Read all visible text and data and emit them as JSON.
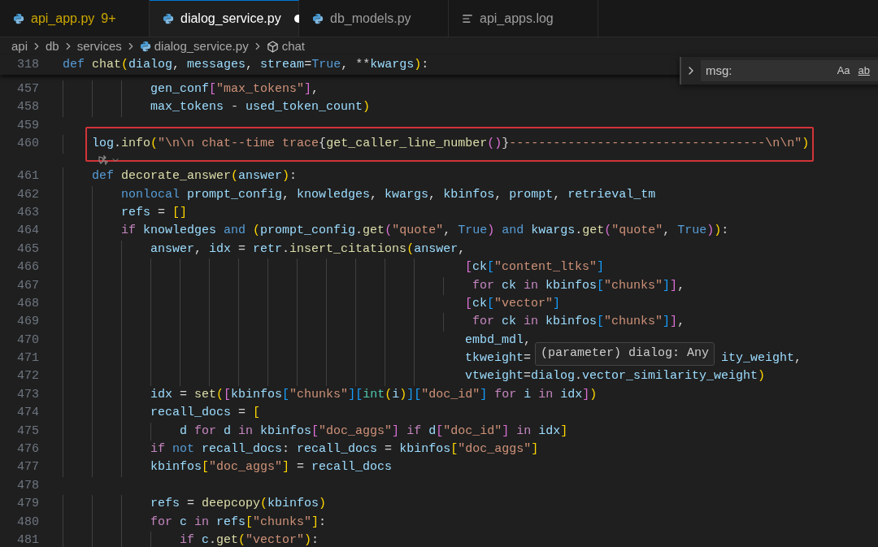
{
  "tabs": [
    {
      "label": "api_app.py",
      "badge": "9+",
      "kind": "python",
      "selected": false,
      "modified": false,
      "errors": true
    },
    {
      "label": "dialog_service.py",
      "kind": "python",
      "selected": true,
      "modified": true,
      "errors": false
    },
    {
      "label": "db_models.py",
      "kind": "python",
      "selected": false,
      "modified": false,
      "errors": false
    },
    {
      "label": "api_apps.log",
      "kind": "log",
      "selected": false,
      "modified": false,
      "errors": false
    }
  ],
  "breadcrumbs": [
    {
      "label": "api",
      "kind": "folder"
    },
    {
      "label": "db",
      "kind": "folder"
    },
    {
      "label": "services",
      "kind": "folder"
    },
    {
      "label": "dialog_service.py",
      "kind": "python"
    },
    {
      "label": "chat",
      "kind": "symbol"
    }
  ],
  "sticky_line": {
    "number": "318",
    "tokens": [
      {
        "kind": "kw",
        "text": "def "
      },
      {
        "kind": "fn",
        "text": "chat"
      },
      {
        "kind": "b1",
        "text": "("
      },
      {
        "kind": "par",
        "text": "dialog"
      },
      {
        "kind": "p",
        "text": ", "
      },
      {
        "kind": "par",
        "text": "messages"
      },
      {
        "kind": "p",
        "text": ", "
      },
      {
        "kind": "par",
        "text": "stream"
      },
      {
        "kind": "p",
        "text": "="
      },
      {
        "kind": "kw",
        "text": "True"
      },
      {
        "kind": "p",
        "text": ", **"
      },
      {
        "kind": "par",
        "text": "kwargs"
      },
      {
        "kind": "b1",
        "text": ")"
      },
      {
        "kind": "p",
        "text": ":"
      }
    ]
  },
  "lines": [
    {
      "number": "457",
      "tokens": [
        {
          "kind": "var",
          "text": "            gen_conf"
        },
        {
          "kind": "b2",
          "text": "["
        },
        {
          "kind": "str",
          "text": "\"max_tokens\""
        },
        {
          "kind": "b2",
          "text": "]"
        },
        {
          "kind": "p",
          "text": ","
        }
      ]
    },
    {
      "number": "458",
      "tokens": [
        {
          "kind": "var",
          "text": "            max_tokens"
        },
        {
          "kind": "p",
          "text": " - "
        },
        {
          "kind": "var",
          "text": "used_token_count"
        },
        {
          "kind": "b1",
          "text": ")"
        }
      ]
    },
    {
      "number": "459"
    },
    {
      "number": "460",
      "highlighted": true,
      "codelens": true,
      "tokens": [
        {
          "kind": "var",
          "text": "    log"
        },
        {
          "kind": "p",
          "text": "."
        },
        {
          "kind": "fn",
          "text": "info"
        },
        {
          "kind": "b1",
          "text": "("
        },
        {
          "kind": "str",
          "text": "\"\\n\\n chat--time trace"
        },
        {
          "kind": "p",
          "text": "{"
        },
        {
          "kind": "fn",
          "text": "get_caller_line_number"
        },
        {
          "kind": "b2",
          "text": "()"
        },
        {
          "kind": "p",
          "text": "}"
        },
        {
          "kind": "str",
          "text": "-----------------------------------\\n\\n\""
        },
        {
          "kind": "b1",
          "text": ")"
        }
      ]
    },
    {
      "number": "461",
      "tokens": [
        {
          "kind": "kw",
          "text": "    def "
        },
        {
          "kind": "fn",
          "text": "decorate_answer"
        },
        {
          "kind": "b1",
          "text": "("
        },
        {
          "kind": "par",
          "text": "answer"
        },
        {
          "kind": "b1",
          "text": ")"
        },
        {
          "kind": "p",
          "text": ":"
        }
      ]
    },
    {
      "number": "462",
      "tokens": [
        {
          "kind": "kw",
          "text": "        nonlocal "
        },
        {
          "kind": "var",
          "text": "prompt_config"
        },
        {
          "kind": "p",
          "text": ", "
        },
        {
          "kind": "var",
          "text": "knowledges"
        },
        {
          "kind": "p",
          "text": ", "
        },
        {
          "kind": "var",
          "text": "kwargs"
        },
        {
          "kind": "p",
          "text": ", "
        },
        {
          "kind": "var",
          "text": "kbinfos"
        },
        {
          "kind": "p",
          "text": ", "
        },
        {
          "kind": "var",
          "text": "prompt"
        },
        {
          "kind": "p",
          "text": ", "
        },
        {
          "kind": "var",
          "text": "retrieval_tm"
        }
      ]
    },
    {
      "number": "463",
      "tokens": [
        {
          "kind": "var",
          "text": "        refs"
        },
        {
          "kind": "p",
          "text": " = "
        },
        {
          "kind": "b1",
          "text": "[]"
        }
      ]
    },
    {
      "number": "464",
      "tokens": [
        {
          "kind": "ctrl",
          "text": "        if "
        },
        {
          "kind": "var",
          "text": "knowledges"
        },
        {
          "kind": "kw",
          "text": " and "
        },
        {
          "kind": "b1",
          "text": "("
        },
        {
          "kind": "var",
          "text": "prompt_config"
        },
        {
          "kind": "p",
          "text": "."
        },
        {
          "kind": "fn",
          "text": "get"
        },
        {
          "kind": "b2",
          "text": "("
        },
        {
          "kind": "str",
          "text": "\"quote\""
        },
        {
          "kind": "p",
          "text": ", "
        },
        {
          "kind": "kw",
          "text": "True"
        },
        {
          "kind": "b2",
          "text": ")"
        },
        {
          "kind": "kw",
          "text": " and "
        },
        {
          "kind": "var",
          "text": "kwargs"
        },
        {
          "kind": "p",
          "text": "."
        },
        {
          "kind": "fn",
          "text": "get"
        },
        {
          "kind": "b2",
          "text": "("
        },
        {
          "kind": "str",
          "text": "\"quote\""
        },
        {
          "kind": "p",
          "text": ", "
        },
        {
          "kind": "kw",
          "text": "True"
        },
        {
          "kind": "b2",
          "text": ")"
        },
        {
          "kind": "b1",
          "text": ")"
        },
        {
          "kind": "p",
          "text": ":"
        }
      ]
    },
    {
      "number": "465",
      "tokens": [
        {
          "kind": "var",
          "text": "            answer"
        },
        {
          "kind": "p",
          "text": ", "
        },
        {
          "kind": "var",
          "text": "idx"
        },
        {
          "kind": "p",
          "text": " = "
        },
        {
          "kind": "var",
          "text": "retr"
        },
        {
          "kind": "p",
          "text": "."
        },
        {
          "kind": "fn",
          "text": "insert_citations"
        },
        {
          "kind": "b1",
          "text": "("
        },
        {
          "kind": "var",
          "text": "answer"
        },
        {
          "kind": "p",
          "text": ","
        }
      ]
    },
    {
      "number": "466",
      "tokens": [
        {
          "kind": "b2",
          "text": "                                                       ["
        },
        {
          "kind": "var",
          "text": "ck"
        },
        {
          "kind": "b3",
          "text": "["
        },
        {
          "kind": "str",
          "text": "\"content_ltks\""
        },
        {
          "kind": "b3",
          "text": "]"
        }
      ]
    },
    {
      "number": "467",
      "tokens": [
        {
          "kind": "ctrl",
          "text": "                                                        for "
        },
        {
          "kind": "var",
          "text": "ck"
        },
        {
          "kind": "ctrl",
          "text": " in "
        },
        {
          "kind": "var",
          "text": "kbinfos"
        },
        {
          "kind": "b3",
          "text": "["
        },
        {
          "kind": "str",
          "text": "\"chunks\""
        },
        {
          "kind": "b3",
          "text": "]"
        },
        {
          "kind": "b2",
          "text": "]"
        },
        {
          "kind": "p",
          "text": ","
        }
      ]
    },
    {
      "number": "468",
      "tokens": [
        {
          "kind": "b2",
          "text": "                                                       ["
        },
        {
          "kind": "var",
          "text": "ck"
        },
        {
          "kind": "b3",
          "text": "["
        },
        {
          "kind": "str",
          "text": "\"vector\""
        },
        {
          "kind": "b3",
          "text": "]"
        }
      ]
    },
    {
      "number": "469",
      "tokens": [
        {
          "kind": "ctrl",
          "text": "                                                        for "
        },
        {
          "kind": "var",
          "text": "ck"
        },
        {
          "kind": "ctrl",
          "text": " in "
        },
        {
          "kind": "var",
          "text": "kbinfos"
        },
        {
          "kind": "b3",
          "text": "["
        },
        {
          "kind": "str",
          "text": "\"chunks\""
        },
        {
          "kind": "b3",
          "text": "]"
        },
        {
          "kind": "b2",
          "text": "]"
        },
        {
          "kind": "p",
          "text": ","
        }
      ]
    },
    {
      "number": "470",
      "tokens": [
        {
          "kind": "var",
          "text": "                                                       embd_mdl"
        },
        {
          "kind": "p",
          "text": ","
        }
      ]
    },
    {
      "number": "471",
      "tokens": [
        {
          "kind": "var",
          "text": "                                                       tkweight"
        },
        {
          "kind": "p",
          "text": "="
        },
        {
          "kind": "var",
          "text": "                          ity_weight"
        },
        {
          "kind": "p",
          "text": ","
        }
      ]
    },
    {
      "number": "472",
      "tokens": [
        {
          "kind": "var",
          "text": "                                                       vtweight"
        },
        {
          "kind": "p",
          "text": "="
        },
        {
          "kind": "var",
          "text": "dialog"
        },
        {
          "kind": "p",
          "text": "."
        },
        {
          "kind": "var",
          "text": "vector_similarity_weight"
        },
        {
          "kind": "b1",
          "text": ")"
        }
      ]
    },
    {
      "number": "473",
      "tokens": [
        {
          "kind": "var",
          "text": "            idx"
        },
        {
          "kind": "p",
          "text": " = "
        },
        {
          "kind": "fn",
          "text": "set"
        },
        {
          "kind": "b1",
          "text": "("
        },
        {
          "kind": "b2",
          "text": "["
        },
        {
          "kind": "var",
          "text": "kbinfos"
        },
        {
          "kind": "b3",
          "text": "["
        },
        {
          "kind": "str",
          "text": "\"chunks\""
        },
        {
          "kind": "b3",
          "text": "]["
        },
        {
          "kind": "cls",
          "text": "int"
        },
        {
          "kind": "b1",
          "text": "("
        },
        {
          "kind": "var",
          "text": "i"
        },
        {
          "kind": "b1",
          "text": ")"
        },
        {
          "kind": "b3",
          "text": "]["
        },
        {
          "kind": "str",
          "text": "\"doc_id\""
        },
        {
          "kind": "b3",
          "text": "]"
        },
        {
          "kind": "ctrl",
          "text": " for "
        },
        {
          "kind": "var",
          "text": "i"
        },
        {
          "kind": "ctrl",
          "text": " in "
        },
        {
          "kind": "var",
          "text": "idx"
        },
        {
          "kind": "b2",
          "text": "]"
        },
        {
          "kind": "b1",
          "text": ")"
        }
      ]
    },
    {
      "number": "474",
      "tokens": [
        {
          "kind": "var",
          "text": "            recall_docs"
        },
        {
          "kind": "p",
          "text": " = "
        },
        {
          "kind": "b1",
          "text": "["
        }
      ]
    },
    {
      "number": "475",
      "tokens": [
        {
          "kind": "var",
          "text": "                d"
        },
        {
          "kind": "ctrl",
          "text": " for "
        },
        {
          "kind": "var",
          "text": "d"
        },
        {
          "kind": "ctrl",
          "text": " in "
        },
        {
          "kind": "var",
          "text": "kbinfos"
        },
        {
          "kind": "b2",
          "text": "["
        },
        {
          "kind": "str",
          "text": "\"doc_aggs\""
        },
        {
          "kind": "b2",
          "text": "]"
        },
        {
          "kind": "ctrl",
          "text": " if "
        },
        {
          "kind": "var",
          "text": "d"
        },
        {
          "kind": "b2",
          "text": "["
        },
        {
          "kind": "str",
          "text": "\"doc_id\""
        },
        {
          "kind": "b2",
          "text": "]"
        },
        {
          "kind": "ctrl",
          "text": " in "
        },
        {
          "kind": "var",
          "text": "idx"
        },
        {
          "kind": "b1",
          "text": "]"
        }
      ]
    },
    {
      "number": "476",
      "tokens": [
        {
          "kind": "ctrl",
          "text": "            if "
        },
        {
          "kind": "kw",
          "text": "not "
        },
        {
          "kind": "var",
          "text": "recall_docs"
        },
        {
          "kind": "p",
          "text": ": "
        },
        {
          "kind": "var",
          "text": "recall_docs"
        },
        {
          "kind": "p",
          "text": " = "
        },
        {
          "kind": "var",
          "text": "kbinfos"
        },
        {
          "kind": "b1",
          "text": "["
        },
        {
          "kind": "str",
          "text": "\"doc_aggs\""
        },
        {
          "kind": "b1",
          "text": "]"
        }
      ]
    },
    {
      "number": "477",
      "tokens": [
        {
          "kind": "var",
          "text": "            kbinfos"
        },
        {
          "kind": "b1",
          "text": "["
        },
        {
          "kind": "str",
          "text": "\"doc_aggs\""
        },
        {
          "kind": "b1",
          "text": "]"
        },
        {
          "kind": "p",
          "text": " = "
        },
        {
          "kind": "var",
          "text": "recall_docs"
        }
      ]
    },
    {
      "number": "478"
    },
    {
      "number": "479",
      "tokens": [
        {
          "kind": "var",
          "text": "            refs"
        },
        {
          "kind": "p",
          "text": " = "
        },
        {
          "kind": "fn",
          "text": "deepcopy"
        },
        {
          "kind": "b1",
          "text": "("
        },
        {
          "kind": "var",
          "text": "kbinfos"
        },
        {
          "kind": "b1",
          "text": ")"
        }
      ]
    },
    {
      "number": "480",
      "tokens": [
        {
          "kind": "ctrl",
          "text": "            for "
        },
        {
          "kind": "var",
          "text": "c"
        },
        {
          "kind": "ctrl",
          "text": " in "
        },
        {
          "kind": "var",
          "text": "refs"
        },
        {
          "kind": "b1",
          "text": "["
        },
        {
          "kind": "str",
          "text": "\"chunks\""
        },
        {
          "kind": "b1",
          "text": "]"
        },
        {
          "kind": "p",
          "text": ":"
        }
      ]
    },
    {
      "number": "481",
      "tokens": [
        {
          "kind": "ctrl",
          "text": "                if "
        },
        {
          "kind": "var",
          "text": "c"
        },
        {
          "kind": "p",
          "text": "."
        },
        {
          "kind": "fn",
          "text": "get"
        },
        {
          "kind": "b1",
          "text": "("
        },
        {
          "kind": "str",
          "text": "\"vector\""
        },
        {
          "kind": "b1",
          "text": ")"
        },
        {
          "kind": "p",
          "text": ":"
        }
      ]
    }
  ],
  "hover_tooltip": {
    "text": "(parameter) dialog: Any"
  },
  "find_widget": {
    "value": "msg:",
    "options": [
      "Aa",
      "ab"
    ]
  }
}
